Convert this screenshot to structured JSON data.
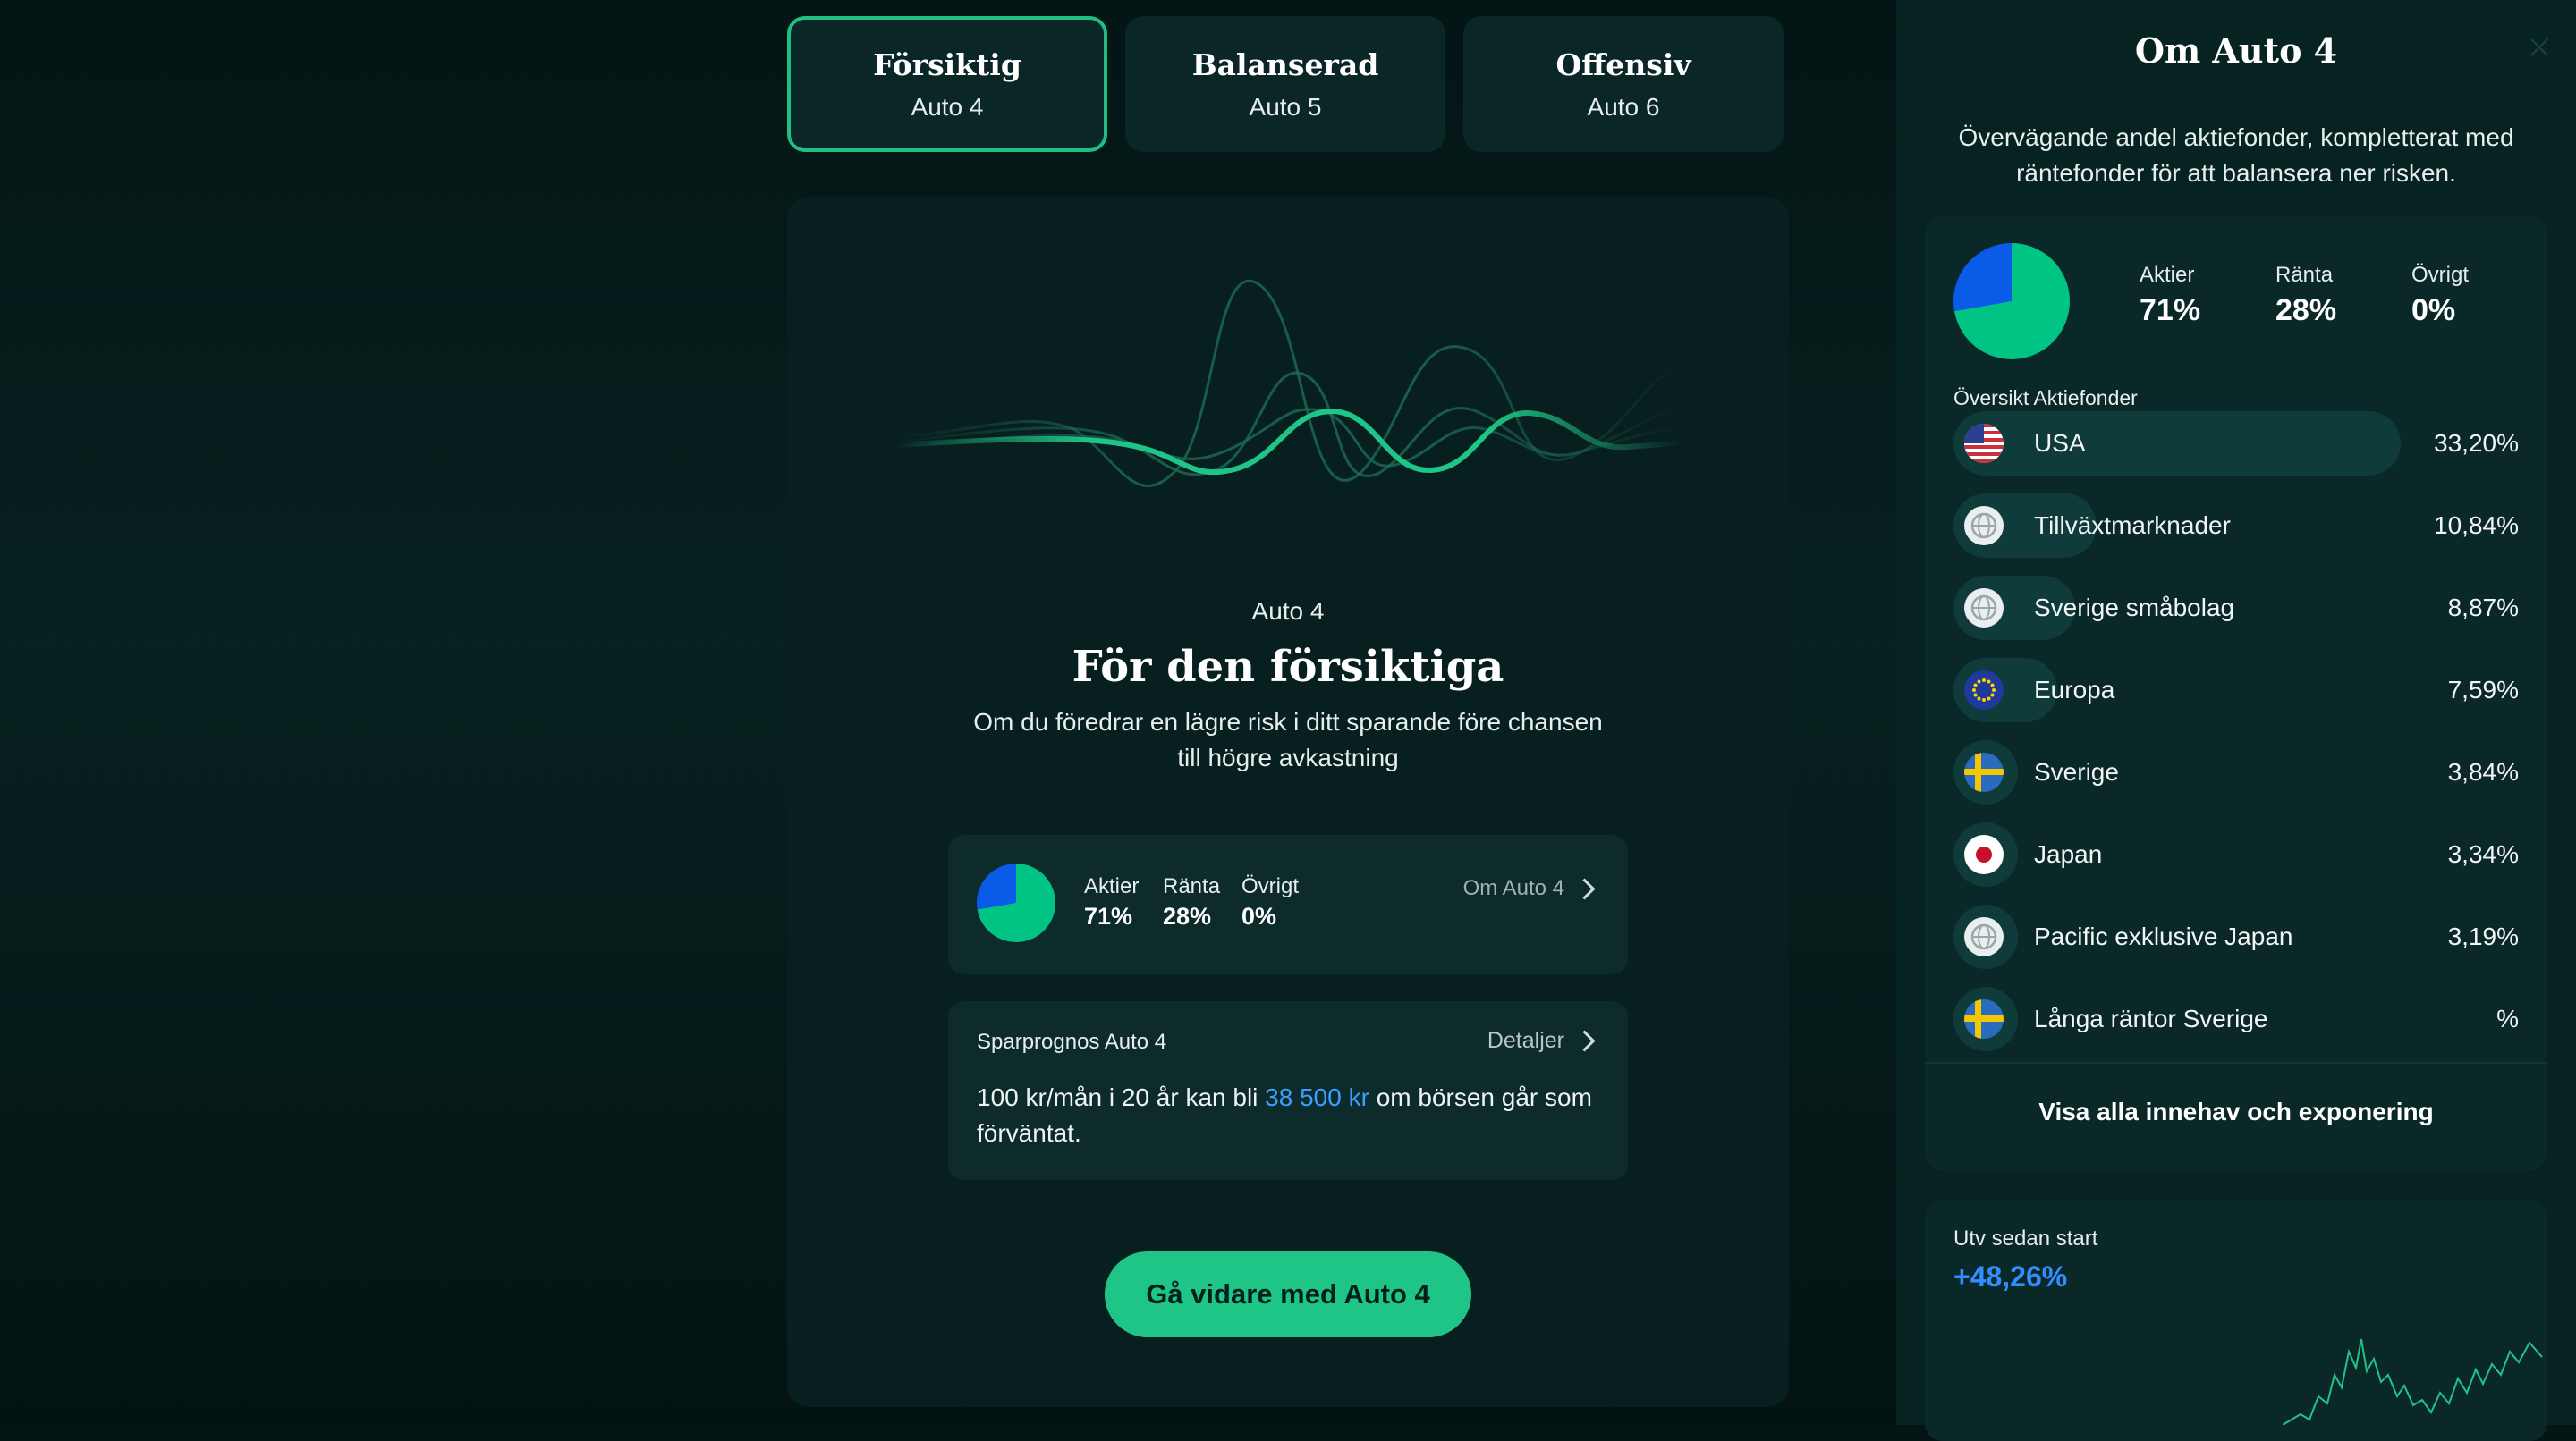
{
  "tabs": [
    {
      "title": "Försiktig",
      "subtitle": "Auto 4"
    },
    {
      "title": "Balanserad",
      "subtitle": "Auto 5"
    },
    {
      "title": "Offensiv",
      "subtitle": "Auto 6"
    }
  ],
  "main": {
    "kicker": "Auto 4",
    "headline": "För den försiktiga",
    "subline": [
      "Om du föredrar en lägre risk i ditt sparande före chansen",
      "till högre avkastning"
    ],
    "allocation": {
      "items": [
        {
          "label": "Aktier",
          "value": "71%"
        },
        {
          "label": "Ränta",
          "value": "28%"
        },
        {
          "label": "Övrigt",
          "value": "0%"
        }
      ],
      "link": "Om Auto 4"
    },
    "forecast": {
      "title": "Sparprognos Auto 4",
      "link": "Detaljer",
      "text_before": "100 kr/mån i 20 år kan bli ",
      "highlight": "38 500 kr",
      "text_after": " om börsen går som förväntat."
    },
    "cta": "Gå vidare med Auto 4"
  },
  "side": {
    "title": "Om Auto 4",
    "description": [
      "Övervägande andel aktiefonder, kompletterat med",
      "räntefonder för att balansera ner risken."
    ],
    "allocation": [
      {
        "label": "Aktier",
        "value": "71%"
      },
      {
        "label": "Ränta",
        "value": "28%"
      },
      {
        "label": "Övrigt",
        "value": "0%"
      }
    ],
    "section_label": "Översikt Aktiefonder",
    "holdings": [
      {
        "name": "USA",
        "pct": "33,20%",
        "icon": "us-flag-icon",
        "share": 33.2
      },
      {
        "name": "Tillväxtmarknader",
        "pct": "10,84%",
        "icon": "globe-icon",
        "share": 10.84
      },
      {
        "name": "Sverige småbolag",
        "pct": "8,87%",
        "icon": "globe-icon",
        "share": 8.87
      },
      {
        "name": "Europa",
        "pct": "7,59%",
        "icon": "eu-flag-icon",
        "share": 7.59
      },
      {
        "name": "Sverige",
        "pct": "3,84%",
        "icon": "sweden-flag-icon",
        "share": 3.84
      },
      {
        "name": "Japan",
        "pct": "3,34%",
        "icon": "japan-flag-icon",
        "share": 3.34
      },
      {
        "name": "Pacific exklusive Japan",
        "pct": "3,19%",
        "icon": "globe-icon",
        "share": 3.19
      },
      {
        "name": "Långa räntor Sverige",
        "pct": "%",
        "icon": "sweden-flag-icon",
        "share": 0
      }
    ],
    "show_all": "Visa alla innehav och exponering",
    "performance": {
      "label": "Utv sedan start",
      "value": "+48,26%"
    }
  },
  "colors": {
    "accent_green": "#1fc586",
    "pie_blue": "#0a5be7",
    "highlight_blue": "#3aa0ff"
  }
}
